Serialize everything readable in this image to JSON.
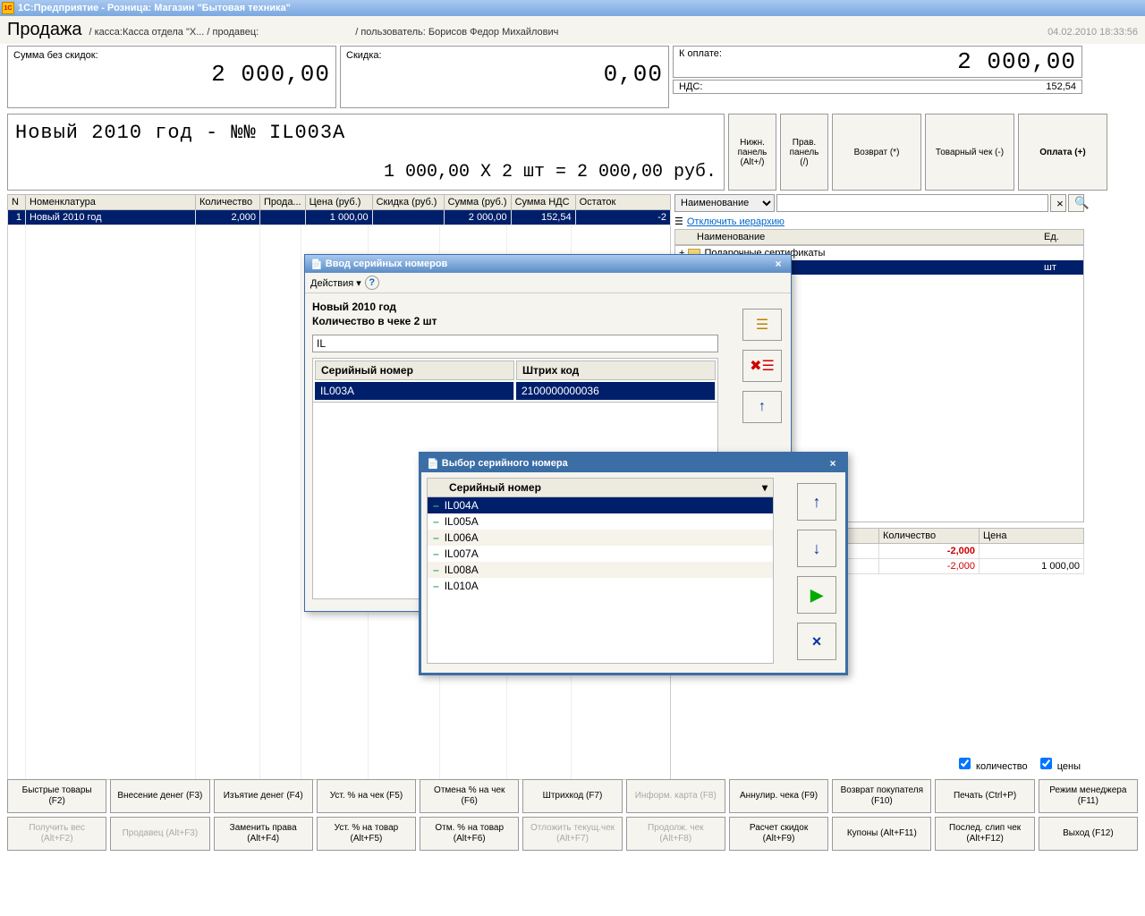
{
  "titlebar": "1С:Предприятие - Розница: Магазин \"Бытовая техника\"",
  "header": {
    "title": "Продажа",
    "crumbs": "/ касса:Касса отдела \"Х... / продавец:",
    "user": "/ пользователь: Борисов Федор Михайлович",
    "datetime": "04.02.2010 18:33:56"
  },
  "totals": {
    "sum_label": "Сумма без скидок:",
    "sum_value": "2 000,00",
    "discount_label": "Скидка:",
    "discount_value": "0,00",
    "pay_label": "К оплате:",
    "pay_value": "2 000,00",
    "vat_label": "НДС:",
    "vat_value": "152,54"
  },
  "top_buttons": {
    "lower_panel": "Нижн. панель (Alt+/)",
    "right_panel": "Прав. панель (/)",
    "return": "Возврат (*)",
    "receipt": "Товарный чек (-)",
    "payment": "Оплата (+)"
  },
  "item": {
    "name": "Новый 2010 год - №№ IL003A",
    "calc": "1 000,00  Х 2 шт = 2 000,00  руб."
  },
  "grid": {
    "headers": [
      "N",
      "Номенклатура",
      "Количество",
      "Прода...",
      "Цена (руб.)",
      "Скидка (руб.)",
      "Сумма (руб.)",
      "Сумма НДС",
      "Остаток"
    ],
    "row": {
      "n": "1",
      "nom": "Новый 2010 год",
      "qty": "2,000",
      "seller": "",
      "price": "1 000,00",
      "disc": "",
      "sum": "2 000,00",
      "vat": "152,54",
      "rest": "-2"
    }
  },
  "filter": {
    "field": "Наименование",
    "hierarchy_link": "Отключить иерархию",
    "col_name": "Наименование",
    "col_unit": "Ед.",
    "cat1": "Подарочные сертификаты",
    "selected_unit": "шт"
  },
  "subgrid": {
    "qty_header": "Количество",
    "price_header": "Цена",
    "qty1": "-2,000",
    "qty2": "-2,000",
    "price1": "",
    "price2": "1 000,00"
  },
  "checks": {
    "qty": "количество",
    "prices": "цены"
  },
  "dialog_serial": {
    "title": "Ввод серийных номеров",
    "actions": "Действия",
    "item_name": "Новый 2010 год",
    "qty_info": "Количество в чеке 2 шт",
    "input_value": "IL",
    "col_serial": "Серийный номер",
    "col_barcode": "Штрих код",
    "serial": "IL003A",
    "barcode": "2100000000036"
  },
  "dialog_select": {
    "title": "Выбор серийного номера",
    "col": "Серийный номер",
    "items": [
      "IL004A",
      "IL005A",
      "IL006A",
      "IL007A",
      "IL008A",
      "IL010A"
    ]
  },
  "bottom": [
    "Быстрые товары (F2)",
    "Внесение денег (F3)",
    "Изъятие денег (F4)",
    "Уст. % на чек (F5)",
    "Отмена % на чек (F6)",
    "Штрихкод (F7)",
    "Информ. карта (F8)",
    "Аннулир. чека (F9)",
    "Возврат покупателя (F10)",
    "Печать (Ctrl+P)",
    "Режим менеджера (F11)",
    "Получить вес (Alt+F2)",
    "Продавец (Alt+F3)",
    "Заменить права (Alt+F4)",
    "Уст. % на товар (Alt+F5)",
    "Отм. % на товар (Alt+F6)",
    "Отложить текущ.чек (Alt+F7)",
    "Продолж. чек (Alt+F8)",
    "Расчет скидок (Alt+F9)",
    "Купоны (Alt+F11)",
    "Послед. слип чек (Alt+F12)",
    "Выход (F12)"
  ]
}
